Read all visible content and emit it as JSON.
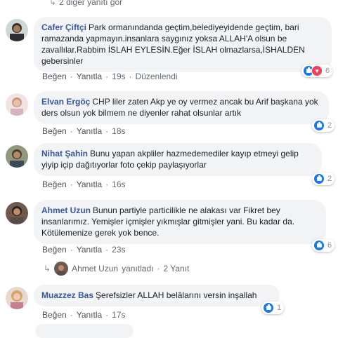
{
  "top_replies": {
    "label": "2 diğer yanıtı gör"
  },
  "comments": [
    {
      "author": "Cafer Çiftçi",
      "text": "Park ormanındanda geçtim,belediyeyidende geçtim, bari ramazanda yapmayın.insanlara saygınız yoksa ALLAH'A olsun be zavallılar.Rabbim İSLAH EYLESİN.Eğer İSLAH olmazlarsa,İSHALDEN gebersinler",
      "like": "Beğen",
      "reply": "Yanıtla",
      "time": "19s",
      "edited": "Düzenlendi",
      "reaction_count": "6"
    },
    {
      "author": "Elvan Ergöç",
      "text": "CHP liler zaten Akp ye oy vermez ancak bu Arif başkana yok ders olsun yok bilmem ne diyenler rahat olsunlar artık",
      "like": "Beğen",
      "reply": "Yanıtla",
      "time": "18s",
      "reaction_count": "2"
    },
    {
      "author": "Nihat Şahin",
      "text": "Bunu yapan akpliler hazmedemediler kayıp etmeyi gelip yiyip içip dağıtıyorlar foto çekip paylaşıyorlar",
      "like": "Beğen",
      "reply": "Yanıtla",
      "time": "16s",
      "reaction_count": "2"
    },
    {
      "author": "Ahmet Uzun",
      "text": "Bunun partiyle particilikle ne alakası var Fikret bey insanlarımız. Yemişler içmişler yıkmışlar gitmişler yani. Bu kadar da. Kötülemenize gerek yok bence.",
      "like": "Beğen",
      "reply": "Yanıtla",
      "time": "23s",
      "reaction_count": "6"
    },
    {
      "author": "Muazzez Bas",
      "text": "Şerefsizler ALLAH belâlarını versin inşallah",
      "like": "Beğen",
      "reply": "Yanıtla",
      "time": "17s",
      "reaction_count": "1"
    }
  ],
  "reply_summary": {
    "author": "Ahmet Uzun",
    "action": "yanıtladı",
    "dot": "·",
    "count": "2 Yanıt"
  },
  "colors": {
    "author": "#385898",
    "bubble": "#f2f3f5",
    "like": "#1877f2",
    "love": "#f33e58"
  }
}
